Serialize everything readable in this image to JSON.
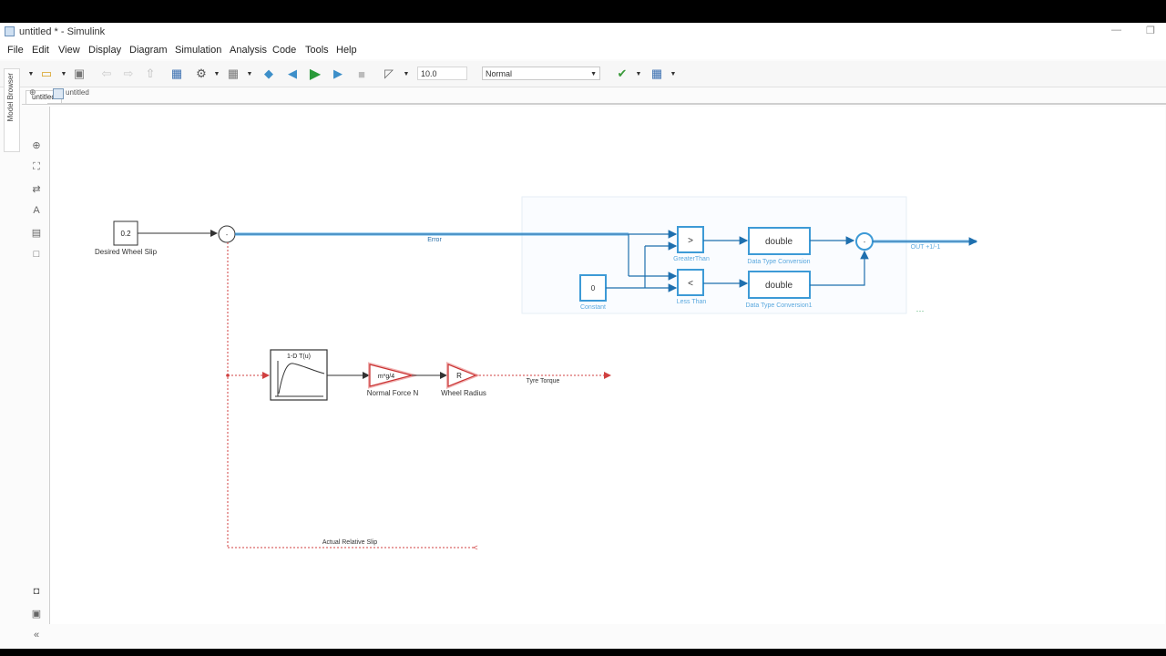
{
  "window": {
    "title": "untitled * - Simulink"
  },
  "menu": [
    "File",
    "Edit",
    "View",
    "Display",
    "Diagram",
    "Simulation",
    "Analysis",
    "Code",
    "Tools",
    "Help"
  ],
  "toolbar": {
    "stop_time": "10.0",
    "sim_mode": "Normal"
  },
  "tabs": [
    "untitled"
  ],
  "side_browser_label": "Model Browser",
  "breadcrumb": "untitled",
  "blocks": {
    "desired_slip": {
      "value": "0.2",
      "label": "Desired Wheel Slip"
    },
    "lookup": {
      "title": "1-D T(u)"
    },
    "gain_normal": {
      "value": "m*g/4",
      "label": "Normal Force N"
    },
    "gain_radius": {
      "value": "R",
      "label": "Wheel Radius"
    },
    "greater": {
      "symbol": ">",
      "label": "GreaterThan"
    },
    "less": {
      "symbol": "<",
      "label": "Less Than"
    },
    "constant": {
      "value": "0",
      "label": "Constant"
    },
    "dtc1": {
      "value": "double",
      "label": "Data Type Conversion"
    },
    "dtc2": {
      "value": "double",
      "label": "Data Type Conversion1"
    }
  },
  "signals": {
    "error": "Error",
    "tyre_torque": "Tyre Torque",
    "actual_slip": "Actual Relative Slip",
    "out": "OUT +1/-1"
  },
  "colors": {
    "selection": "#3d9ad6",
    "highlight_red": "#e05555",
    "line": "#333333"
  }
}
